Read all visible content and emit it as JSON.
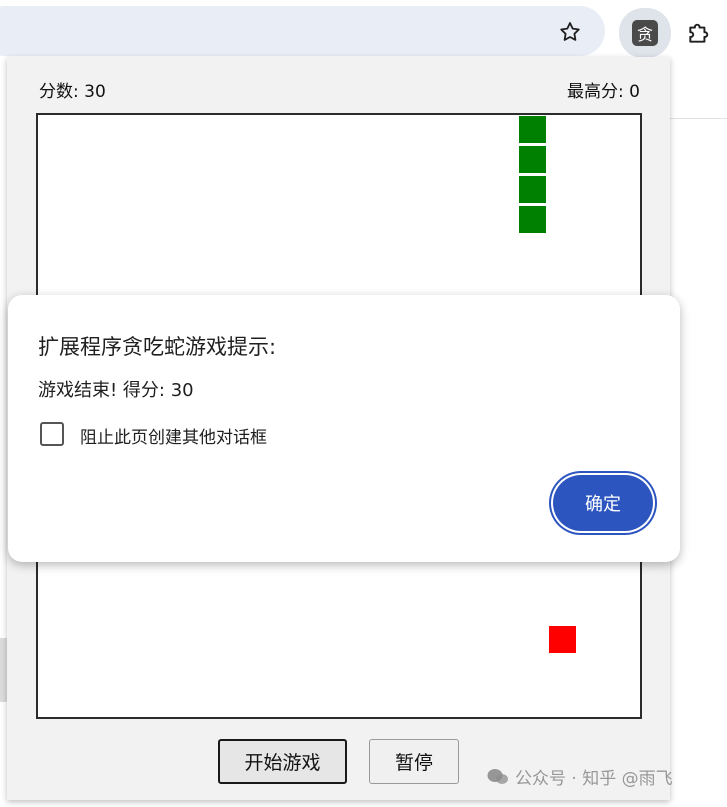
{
  "browser": {
    "bookmark_icon": "star-icon",
    "extension_icon_glyph": "贪",
    "extensions_icon": "puzzle-icon"
  },
  "popup": {
    "score_text": "分数: 30",
    "high_score_text": "最高分: 0",
    "buttons": {
      "start": "开始游戏",
      "pause": "暂停"
    },
    "colors": {
      "snake": "#008000",
      "food": "#ff0000",
      "board_border": "#2b2b2b"
    }
  },
  "game": {
    "grid_size": 20,
    "snake": [
      [
        16,
        0
      ],
      [
        16,
        1
      ],
      [
        16,
        2
      ],
      [
        16,
        3
      ]
    ],
    "food": [
      17,
      17
    ]
  },
  "dialog": {
    "title": "扩展程序贪吃蛇游戏提示:",
    "message": "游戏结束! 得分: 30",
    "checkbox_label": "阻止此页创建其他对话框",
    "checkbox_checked": false,
    "ok_button": "确定",
    "accent_color": "#2d55c0"
  },
  "watermark": {
    "text": "公众号 · 知乎 @雨飞"
  }
}
